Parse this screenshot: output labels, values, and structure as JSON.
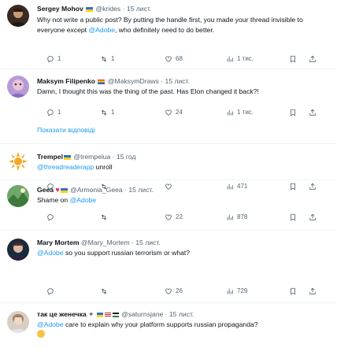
{
  "tweets": [
    {
      "name": "Sergey Mohov",
      "handle": "@krides",
      "dot": "·",
      "time": "15 лист.",
      "text_before": "Why not write a public post? By putting the handle first, you made your thread invisible to everyone except ",
      "mention": "@Adobe",
      "text_after": ", who definitely need to do better.",
      "replies": "1",
      "retweets": "1",
      "likes": "68",
      "views": "1 тис."
    },
    {
      "name": "Maksym Filipenko",
      "handle": "@MaksymDraws",
      "dot": "·",
      "time": "15 лист.",
      "text": "Damn, I thought this was the thing of the past. Has Elon changed it back?!",
      "replies": "1",
      "retweets": "1",
      "likes": "24",
      "views": "1 тис."
    },
    {
      "name": "Trempel",
      "handle": "@trempelua",
      "dot": "·",
      "time": "15 год",
      "mention": "@threadreaderapp",
      "text_after": " unroll",
      "views": "471"
    },
    {
      "name": "Geea",
      "handle": "@Armonia_Geea",
      "dot": "·",
      "time": "15 лист.",
      "text_before": "Shame on ",
      "mention": "@Adobe",
      "likes": "22",
      "views": "878"
    },
    {
      "name": "Mary Mortem",
      "handle": "@Mary_Mortem",
      "dot": "·",
      "time": "15 лист.",
      "mention": "@Adobe",
      "text_after": " so you support russian terrorism or what?",
      "likes": "26",
      "views": "729"
    },
    {
      "name": "так це женечка",
      "handle": "@saturnsjane",
      "dot": "·",
      "time": "15 лист.",
      "mention": "@Adobe",
      "text_after": " care to explain why your platform supports russian propaganda?"
    }
  ],
  "show_replies": "Показати відповіді",
  "colors": {
    "accent": "#1d9bf0",
    "muted": "#536471",
    "text": "#0f1419",
    "divider": "#eff3f4"
  }
}
